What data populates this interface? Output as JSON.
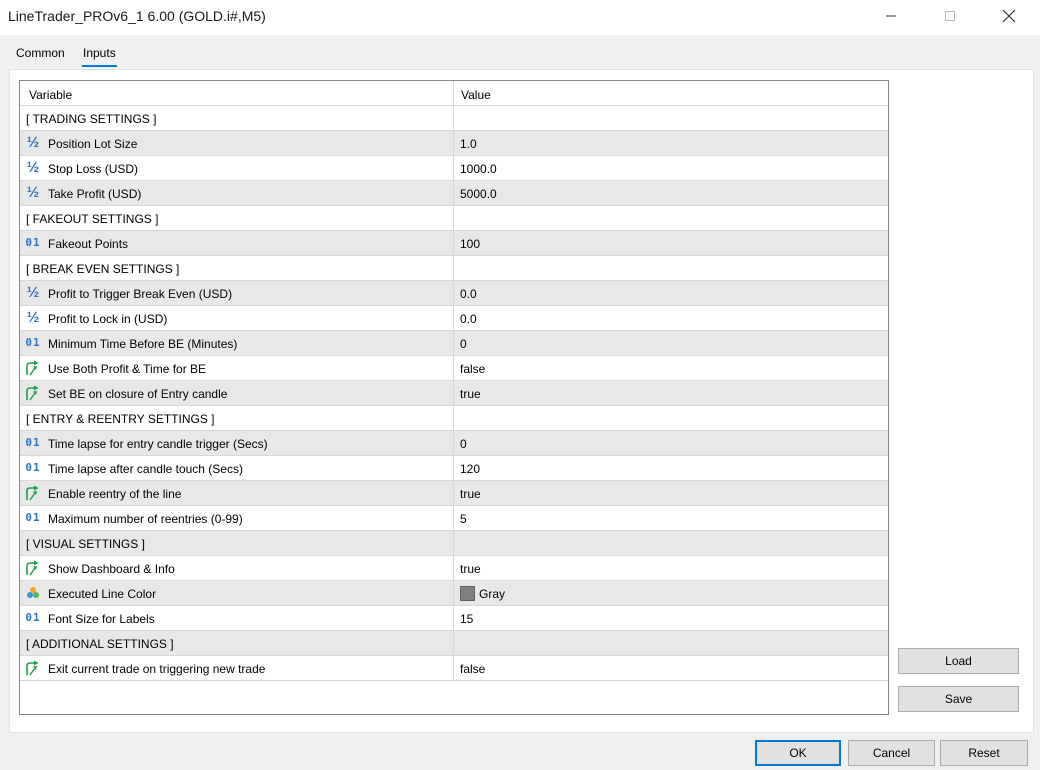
{
  "window": {
    "title": "LineTrader_PROv6_1 6.00 (GOLD.i#,M5)"
  },
  "tabs": [
    {
      "label": "Common"
    },
    {
      "label": "Inputs"
    }
  ],
  "grid": {
    "header": {
      "variable": "Variable",
      "value": "Value"
    },
    "rows": [
      {
        "type": "section",
        "name": "[ TRADING SETTINGS ]",
        "value": ""
      },
      {
        "type": "double",
        "icon": "½",
        "name": "Position Lot Size",
        "value": "1.0"
      },
      {
        "type": "double",
        "icon": "½",
        "name": "Stop Loss (USD)",
        "value": "1000.0"
      },
      {
        "type": "double",
        "icon": "½",
        "name": "Take Profit (USD)",
        "value": "5000.0"
      },
      {
        "type": "section",
        "name": "[ FAKEOUT SETTINGS ]",
        "value": ""
      },
      {
        "type": "int",
        "icon": "01",
        "name": "Fakeout Points",
        "value": "100"
      },
      {
        "type": "section",
        "name": "[ BREAK EVEN SETTINGS ]",
        "value": ""
      },
      {
        "type": "double",
        "icon": "½",
        "name": "Profit to Trigger Break Even (USD)",
        "value": "0.0"
      },
      {
        "type": "double",
        "icon": "½",
        "name": "Profit to Lock in (USD)",
        "value": "0.0"
      },
      {
        "type": "int",
        "icon": "01",
        "name": "Minimum Time Before BE (Minutes)",
        "value": "0"
      },
      {
        "type": "bool",
        "icon": "bool-arrow",
        "name": "Use Both Profit & Time for BE",
        "value": "false"
      },
      {
        "type": "bool",
        "icon": "bool-arrow",
        "name": "Set BE on closure of Entry candle",
        "value": "true"
      },
      {
        "type": "section",
        "name": "[ ENTRY & REENTRY SETTINGS ]",
        "value": ""
      },
      {
        "type": "int",
        "icon": "01",
        "name": "Time lapse for entry candle trigger (Secs)",
        "value": "0"
      },
      {
        "type": "int",
        "icon": "01",
        "name": "Time lapse after candle touch (Secs)",
        "value": "120"
      },
      {
        "type": "bool",
        "icon": "bool-arrow",
        "name": "Enable reentry of the line",
        "value": "true"
      },
      {
        "type": "int",
        "icon": "01",
        "name": "Maximum number of reentries (0-99)",
        "value": "5"
      },
      {
        "type": "section",
        "name": "[ VISUAL SETTINGS ]",
        "value": ""
      },
      {
        "type": "bool",
        "icon": "bool-arrow",
        "name": "Show Dashboard & Info",
        "value": "true"
      },
      {
        "type": "color",
        "icon": "color-palette",
        "name": "Executed Line Color",
        "value": "Gray",
        "swatch": "#808080"
      },
      {
        "type": "int",
        "icon": "01",
        "name": "Font Size for Labels",
        "value": "15"
      },
      {
        "type": "section",
        "name": "[ ADDITIONAL SETTINGS ]",
        "value": ""
      },
      {
        "type": "bool",
        "icon": "bool-arrow",
        "name": "Exit current trade on triggering new trade",
        "value": "false"
      }
    ]
  },
  "side_buttons": {
    "load": "Load",
    "save": "Save"
  },
  "footer_buttons": {
    "ok": "OK",
    "cancel": "Cancel",
    "reset": "Reset"
  },
  "colors": {
    "accent": "#0078d7",
    "row_shaded": "#e8e8e8",
    "icon_blue": "#2e74c0",
    "icon_green": "#1f9e4a"
  }
}
